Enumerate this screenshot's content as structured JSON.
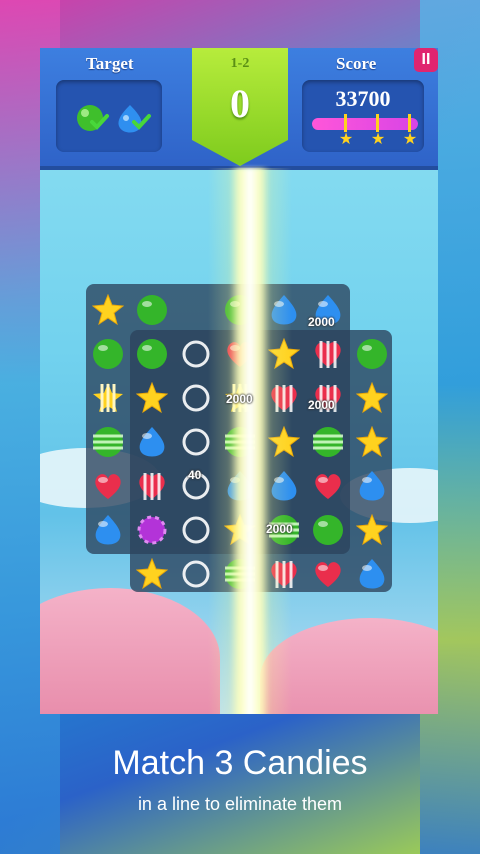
{
  "hud": {
    "target_label": "Target",
    "level_label": "1-2",
    "moves_value": "0",
    "score_label": "Score",
    "score_value": "33700",
    "score_progress": 1.0,
    "stars_earned": 3,
    "pause_label": "II",
    "targets": [
      {
        "candy": "green-round",
        "done": true
      },
      {
        "candy": "blue-drop",
        "done": true
      }
    ]
  },
  "board": {
    "rows": [
      [
        "yellow-star",
        "green-round",
        "empty",
        "green-round",
        "blue-drop",
        "blue-drop"
      ],
      [
        "green-round",
        "green-round",
        "cleared",
        "red-heart",
        "yellow-star",
        "striped-heart",
        "green-round"
      ],
      [
        "striped-star",
        "yellow-star",
        "cleared",
        "striped-star",
        "striped-heart",
        "striped-heart",
        "yellow-star"
      ],
      [
        "striped-round",
        "blue-drop",
        "cleared",
        "striped-round",
        "yellow-star",
        "striped-round",
        "yellow-star"
      ],
      [
        "red-heart",
        "striped-heart",
        "cleared",
        "blue-drop",
        "blue-drop",
        "red-heart",
        "blue-drop"
      ],
      [
        "blue-drop",
        "purple-round",
        "cleared",
        "yellow-star",
        "striped-round",
        "green-round",
        "yellow-star"
      ],
      [
        "",
        "yellow-star",
        "cleared",
        "striped-round",
        "striped-heart",
        "red-heart",
        "blue-drop"
      ]
    ],
    "float_scores": [
      "2000",
      "2000",
      "2000",
      "2000",
      "40"
    ]
  },
  "caption": {
    "main": "Match 3 Candies",
    "sub": "in a line to eliminate them"
  },
  "colors": {
    "hud_blue": "#3a78dc",
    "level_green": "#9ddd2c",
    "pause_pink": "#e0256f",
    "progress_pink": "#ff56d9"
  }
}
